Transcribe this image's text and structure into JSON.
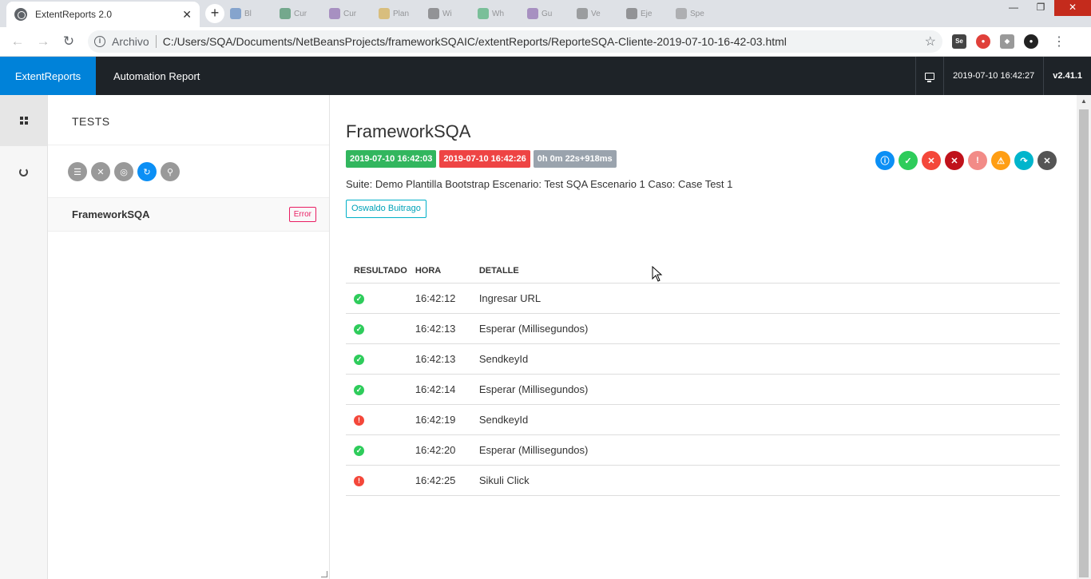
{
  "browser": {
    "tab_title": "ExtentReports 2.0",
    "tab_close": "✕",
    "new_tab": "+",
    "background_tabs": [
      "Bl",
      "Cur",
      "Cur",
      "Plan",
      "Wi",
      "Wh",
      "Gu",
      "Ve",
      "Eje",
      "Spe"
    ],
    "address_scheme_label": "Archivo",
    "url": "C:/Users/SQA/Documents/NetBeansProjects/frameworkSQAIC/extentReports/ReporteSQA-Cliente-2019-07-10-16-42-03.html",
    "window_controls": [
      "—",
      "❐",
      "✕"
    ]
  },
  "report_nav": {
    "brand": "ExtentReports",
    "title": "Automation Report",
    "timestamp": "2019-07-10 16:42:27",
    "version": "v2.41.1"
  },
  "test_panel": {
    "heading": "TESTS",
    "tests": [
      {
        "name": "FrameworkSQA",
        "status": "Error"
      }
    ]
  },
  "detail": {
    "title": "FrameworkSQA",
    "start_time": "2019-07-10 16:42:03",
    "end_time": "2019-07-10 16:42:26",
    "duration": "0h 0m 22s+918ms",
    "description": "Suite: Demo Plantilla Bootstrap Escenario: Test SQA Escenario 1 Caso: Case Test 1",
    "author": "Oswaldo Buitrago",
    "table_headers": {
      "status": "RESULTADO",
      "time": "HORA",
      "detail": "DETALLE"
    },
    "logs": [
      {
        "status": "pass",
        "time": "16:42:12",
        "detail": "Ingresar URL"
      },
      {
        "status": "pass",
        "time": "16:42:13",
        "detail": "Esperar (Millisegundos)"
      },
      {
        "status": "pass",
        "time": "16:42:13",
        "detail": "SendkeyId"
      },
      {
        "status": "pass",
        "time": "16:42:14",
        "detail": "Esperar (Millisegundos)"
      },
      {
        "status": "fail",
        "time": "16:42:19",
        "detail": "SendkeyId"
      },
      {
        "status": "pass",
        "time": "16:42:20",
        "detail": "Esperar (Millisegundos)"
      },
      {
        "status": "fail",
        "time": "16:42:25",
        "detail": "Sikuli Click"
      }
    ]
  },
  "colors": {
    "brand_blue": "#0082d9",
    "nav_dark": "#1e2328",
    "pass_green": "#2ecc5b",
    "fail_red": "#f4473a",
    "start_chip": "#32b65e",
    "end_chip": "#ee4444",
    "duration_chip": "#9aa3ad"
  }
}
